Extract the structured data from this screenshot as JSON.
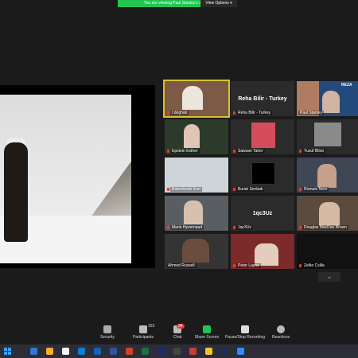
{
  "banner": {
    "viewing_text": "You are viewing Paul Stanley's screen",
    "view_options_label": "View Options ▾"
  },
  "tiles": [
    {
      "name": "t.deghati",
      "active": true
    },
    {
      "name": "Reha Bilir - Turkey",
      "center": "Reha Bilir - Turkey"
    },
    {
      "name": "Paul Stanley"
    },
    {
      "name": "Epstein Esther"
    },
    {
      "name": "Sawsan Taher"
    },
    {
      "name": "Yusuf Biton"
    },
    {
      "name": "Batschinski Kurt"
    },
    {
      "name": "Burak Senbak"
    },
    {
      "name": "Romain Nero"
    },
    {
      "name": "Marie Hyvernaud"
    },
    {
      "name": "1qc3Uz",
      "center": "1qc3Uz"
    },
    {
      "name": "Douglas MacRae Brown"
    },
    {
      "name": "Ahmed Russell"
    },
    {
      "name": "Peter Layne"
    },
    {
      "name": "Zelko Csilla"
    }
  ],
  "toolbar": {
    "security": "Security",
    "participants": "Participants",
    "participants_count": "163",
    "chat": "Chat",
    "chat_badge": "34",
    "share_screen": "Share Screen",
    "pause_recording": "Pause/Stop Recording",
    "reactions": "Reactions"
  },
  "share_thumb_label": "REZA"
}
